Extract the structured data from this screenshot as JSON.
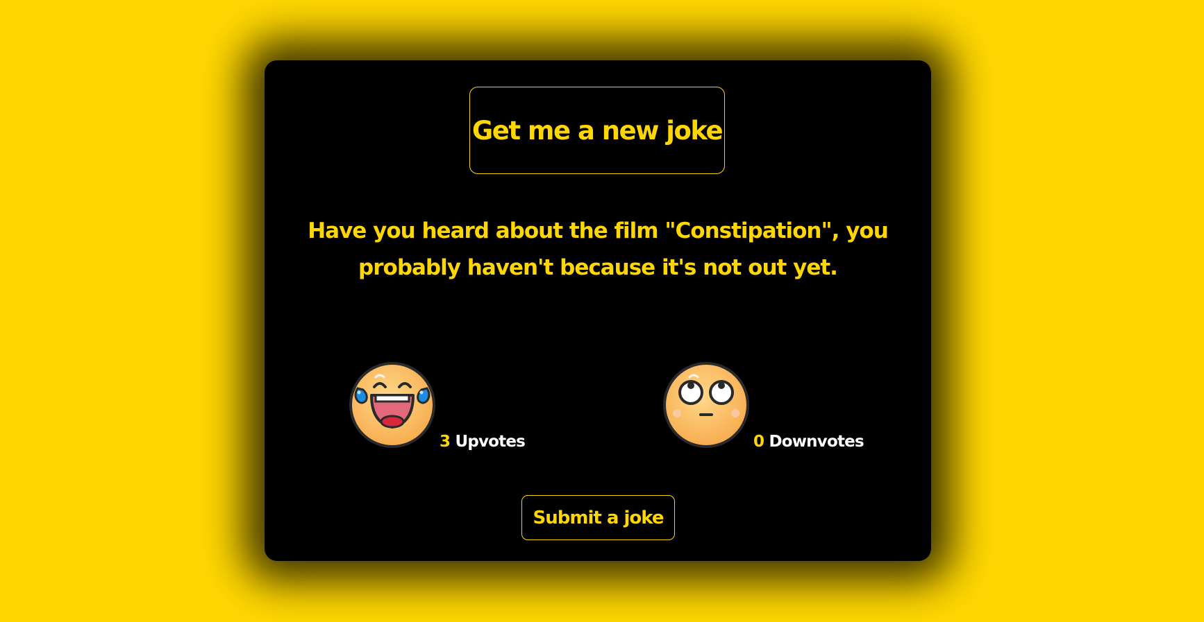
{
  "buttons": {
    "new_joke": "Get me a new joke",
    "submit_joke": "Submit a joke"
  },
  "joke": {
    "text": "Have you heard about the film \"Constipation\", you probably haven't because it's not out yet."
  },
  "votes": {
    "up": {
      "count": "3",
      "label": "Upvotes",
      "icon": "laughing-crying-emoji-icon"
    },
    "down": {
      "count": "0",
      "label": "Downvotes",
      "icon": "eye-roll-emoji-icon"
    }
  },
  "colors": {
    "accent": "#FFD700",
    "card_bg": "#000000",
    "page_bg": "#FFD700",
    "label_text": "#FFFFFF"
  }
}
